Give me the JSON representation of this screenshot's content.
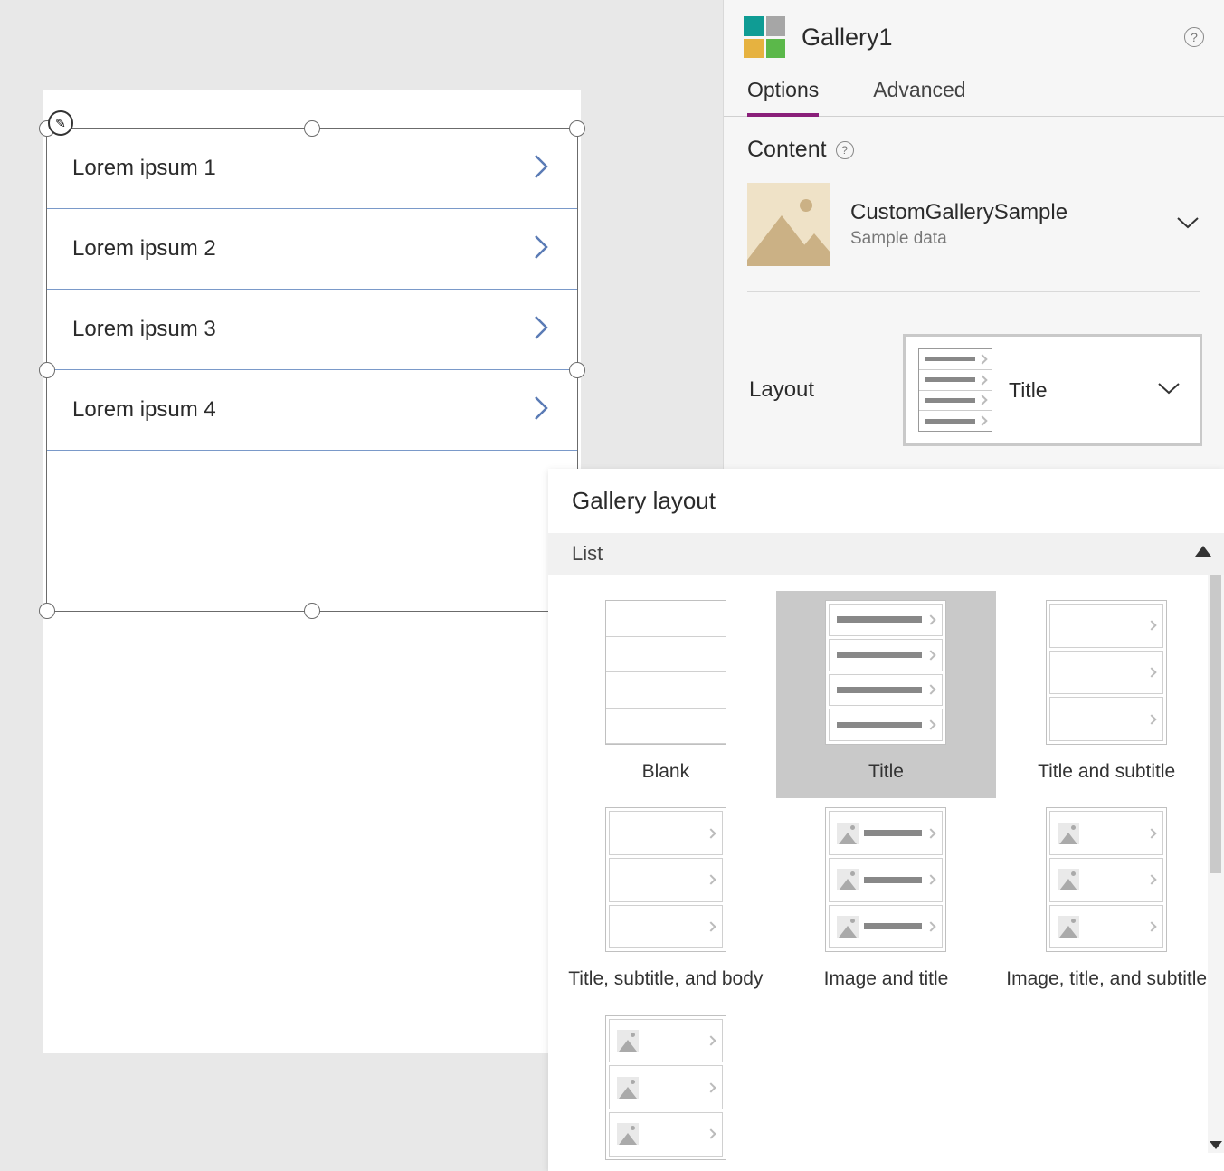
{
  "canvas": {
    "gallery_items": [
      "Lorem ipsum 1",
      "Lorem ipsum 2",
      "Lorem ipsum 3",
      "Lorem ipsum 4"
    ]
  },
  "panel": {
    "title": "Gallery1",
    "tabs": {
      "options": "Options",
      "advanced": "Advanced"
    },
    "content": {
      "heading": "Content",
      "datasource_name": "CustomGallerySample",
      "datasource_sub": "Sample data"
    },
    "layout": {
      "label": "Layout",
      "selected": "Title"
    }
  },
  "popup": {
    "title": "Gallery layout",
    "group": "List",
    "options": {
      "blank": "Blank",
      "title": "Title",
      "title_subtitle": "Title and subtitle",
      "title_subtitle_body": "Title, subtitle, and body",
      "image_title": "Image and title",
      "image_title_subtitle": "Image, title, and subtitle"
    }
  }
}
